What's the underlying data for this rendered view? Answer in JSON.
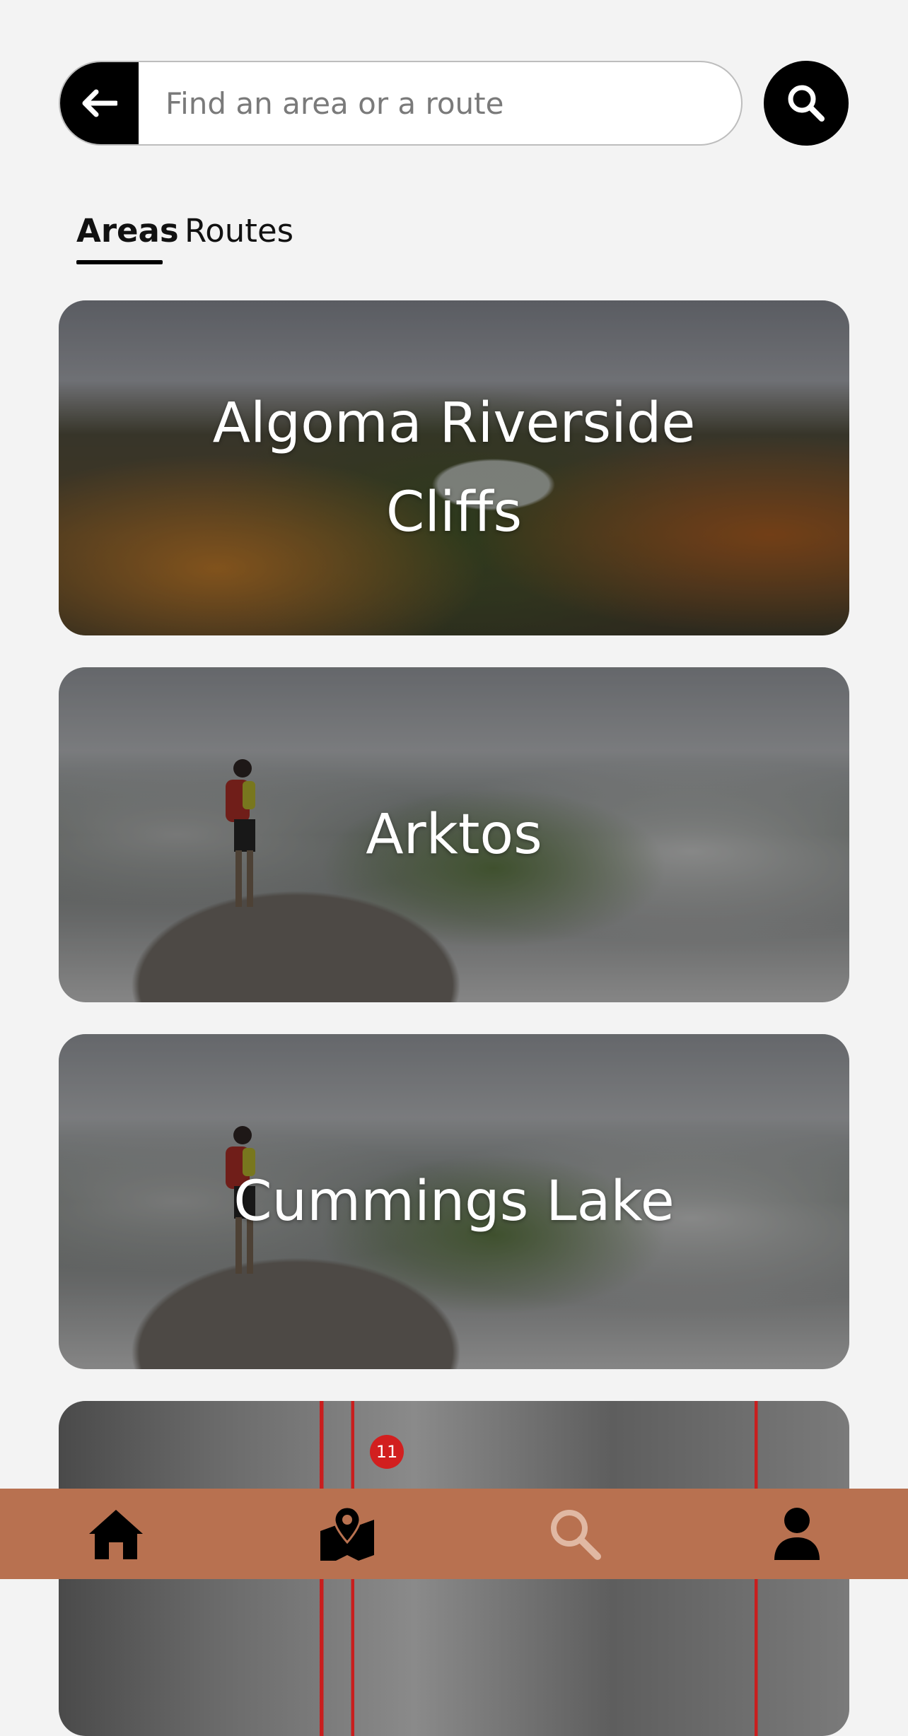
{
  "search": {
    "placeholder": "Find an area or a route",
    "value": ""
  },
  "tabs": [
    {
      "label": "Areas",
      "active": true
    },
    {
      "label": "Routes",
      "active": false
    }
  ],
  "areas": [
    {
      "name": "Algoma Riverside Cliffs"
    },
    {
      "name": "Arktos"
    },
    {
      "name": "Cummings Lake"
    },
    {
      "name": ""
    }
  ],
  "partial_card": {
    "route_badge": "11"
  },
  "nav": {
    "items": [
      {
        "icon": "home-icon"
      },
      {
        "icon": "map-icon"
      },
      {
        "icon": "search-icon",
        "active": true
      },
      {
        "icon": "profile-icon"
      }
    ]
  },
  "colors": {
    "background": "#f3f3f3",
    "nav_background": "#b87150",
    "nav_active_icon": "#e0b8a3",
    "route_line": "#c81e1e"
  }
}
